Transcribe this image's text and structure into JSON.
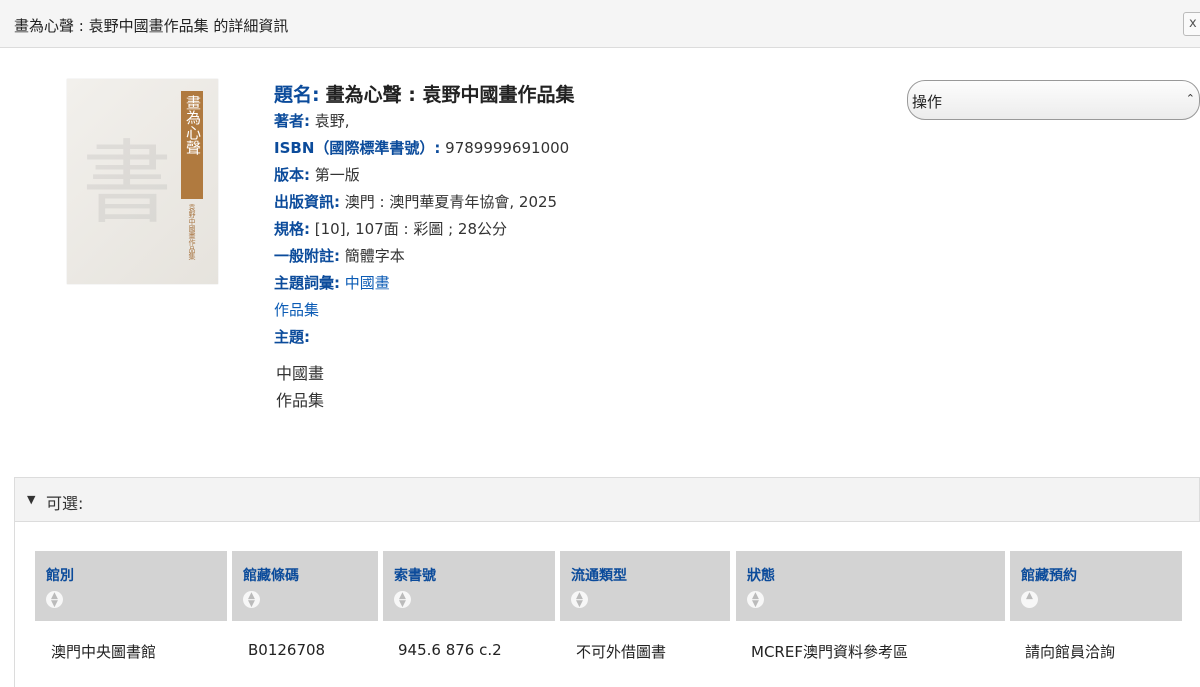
{
  "window": {
    "title": "畫為心聲 : 袁野中國畫作品集 的詳細資訊",
    "close_label": "x"
  },
  "cover": {
    "banner_text": "畫為心聲",
    "subtitle_text": "袁野中國畫作品集",
    "brush_text": "書"
  },
  "record": {
    "title_label": "題名:",
    "title_value": "畫為心聲 : 袁野中國畫作品集",
    "author_label": "著者:",
    "author_value": "袁野,",
    "isbn_label": "ISBN（國際標準書號）:",
    "isbn_value": "9789999691000",
    "edition_label": "版本:",
    "edition_value": "第一版",
    "publication_label": "出版資訊:",
    "publication_value": "澳門 : 澳門華夏青年協會, 2025",
    "format_label": "規格:",
    "format_value": "[10], 107面 : 彩圖 ; 28公分",
    "note_label": "一般附註:",
    "note_value": "簡體字本",
    "subject_terms_label": "主題詞彙:",
    "subject_term_1": "中國畫",
    "subject_term_2": "作品集",
    "subject_label": "主題:",
    "subjects": [
      "中國畫",
      "作品集"
    ]
  },
  "actions": {
    "select_value": "操作"
  },
  "holdings": {
    "section_label": "可選:",
    "columns": [
      "館別",
      "館藏條碼",
      "索書號",
      "流通類型",
      "狀態",
      "館藏預約"
    ],
    "rows": [
      [
        "澳門中央圖書館",
        "B0126708",
        "945.6 876 c.2",
        "不可外借圖書",
        "MCREF澳門資料參考區",
        "請向館員洽詢"
      ]
    ]
  }
}
